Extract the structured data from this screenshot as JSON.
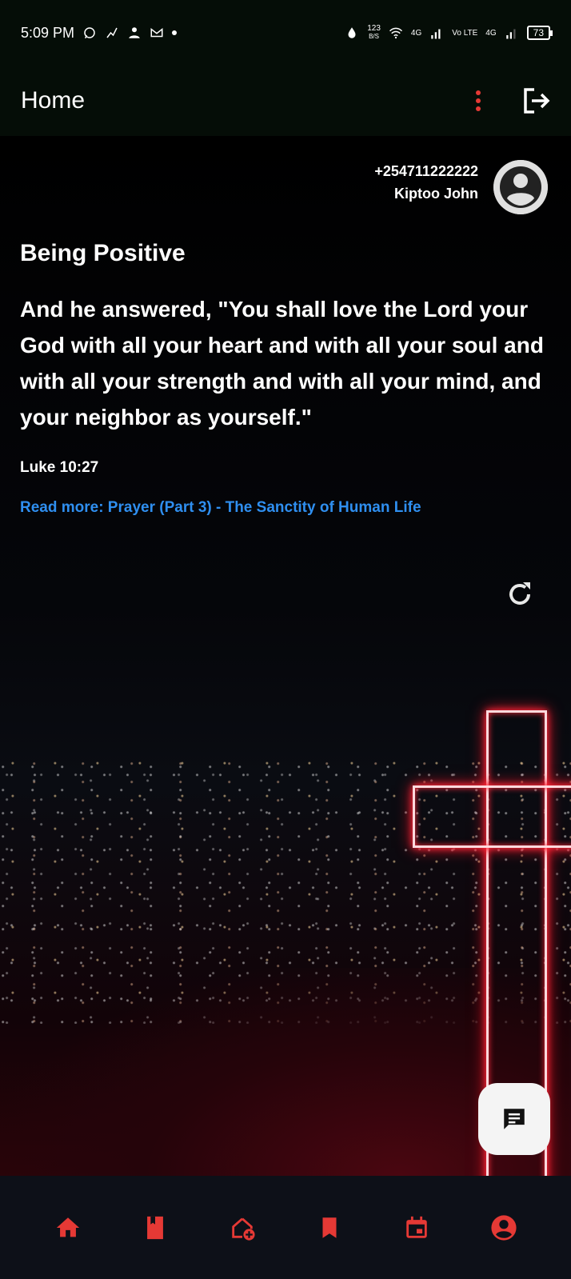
{
  "status_bar": {
    "time": "5:09 PM",
    "data_speed": "123",
    "data_unit": "B/S",
    "net1": "4G",
    "net2": "Vo LTE",
    "net3": "4G",
    "battery": "73"
  },
  "app_bar": {
    "title": "Home",
    "menu_icon": "more-vert-icon",
    "logout_icon": "logout-icon",
    "accent_color": "#e53935"
  },
  "user": {
    "phone": "+254711222222",
    "name": "Kiptoo John"
  },
  "devotion": {
    "title": "Being Positive",
    "verse": "And he answered, \"You shall love the Lord your God with all your heart and with all your soul and with all your strength and with all your mind, and your neighbor as yourself.\"",
    "reference": "Luke 10:27",
    "read_more": "Read more: Prayer (Part 3) - The Sanctity of Human Life",
    "link_color": "#2f8ff0"
  },
  "bottom_nav": {
    "items": [
      {
        "icon": "home-icon"
      },
      {
        "icon": "book-icon"
      },
      {
        "icon": "add-home-icon"
      },
      {
        "icon": "bookmark-icon"
      },
      {
        "icon": "calendar-icon"
      },
      {
        "icon": "account-icon"
      }
    ],
    "icon_color": "#e53935"
  }
}
